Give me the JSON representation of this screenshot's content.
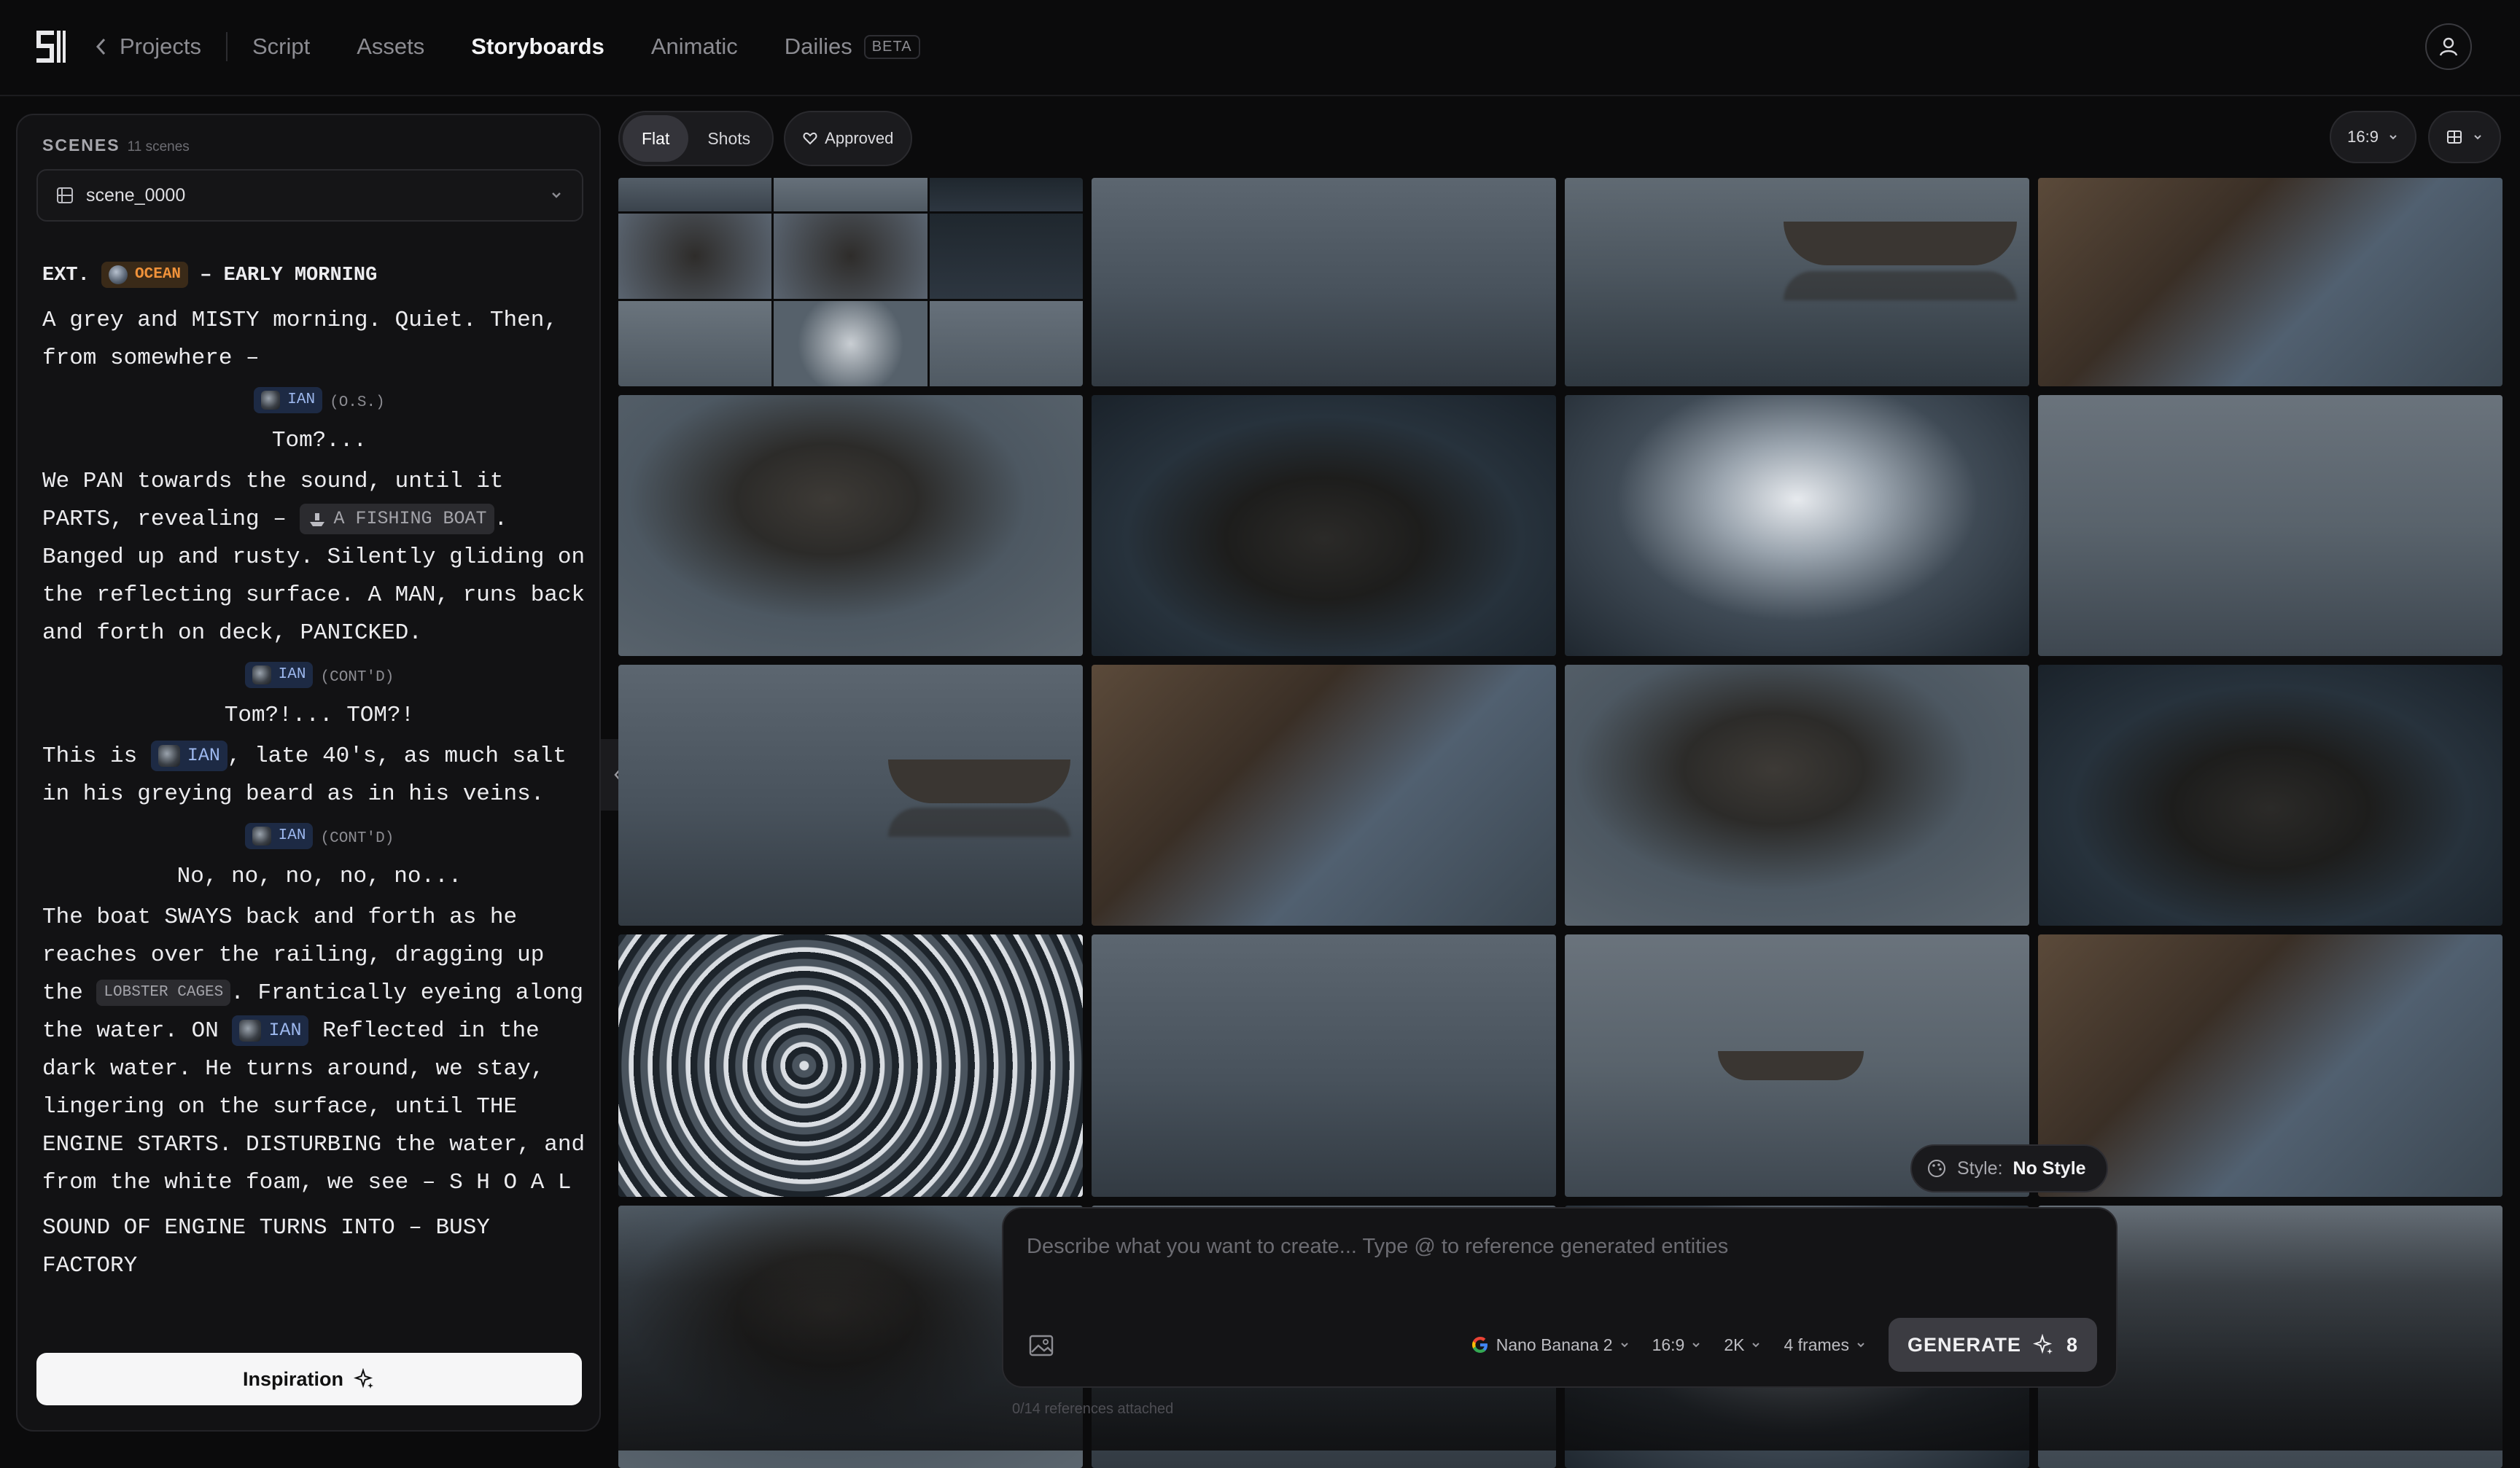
{
  "nav": {
    "back_label": "Projects",
    "tabs": [
      {
        "label": "Script"
      },
      {
        "label": "Assets"
      },
      {
        "label": "Storyboards"
      },
      {
        "label": "Animatic"
      },
      {
        "label": "Dailies"
      }
    ],
    "active_tab": "Storyboards",
    "dailies_badge": "BETA"
  },
  "sidebar": {
    "header": "SCENES",
    "count": "11 scenes",
    "selected_scene": "scene_0000",
    "inspiration_label": "Inspiration"
  },
  "script": {
    "slug_prefix": "EXT.",
    "location_tag": "OCEAN",
    "slug_suffix": "– EARLY MORNING",
    "p1": "A grey and MISTY morning. Quiet. Then, from somewhere –",
    "char_ian": "IAN",
    "os": "(O.S.)",
    "line1": "Tom?...",
    "p2a": "We PAN towards the sound, until it PARTS, revealing –",
    "boat_tag": "A FISHING BOAT",
    "p2b": ". Banged up and rusty. Silently gliding on the reflecting surface. A MAN, runs back and forth on deck, PANICKED.",
    "contd": "(CONT'D)",
    "line2": "Tom?!... TOM?!",
    "p3a": "This is",
    "p3b": ", late 40's, as much salt in his greying beard as in his veins.",
    "line3": "No, no, no, no, no...",
    "p4a": "The boat SWAYS back and forth as he reaches over the railing, dragging up the",
    "cages_tag": "LOBSTER CAGES",
    "p4b": ". Frantically eyeing along the water. ON",
    "p4c": "Reflected in the dark water. He turns around, we stay, lingering on the surface, until THE ENGINE STARTS. DISTURBING the water, and from the white foam, we see – S H O A L",
    "p5": "SOUND OF ENGINE TURNS INTO – BUSY FACTORY"
  },
  "toolbar": {
    "view_options": [
      "Flat",
      "Shots"
    ],
    "active_view": "Flat",
    "approved_label": "Approved",
    "aspect_ratio": "16:9"
  },
  "style_chip": {
    "label": "Style:",
    "value": "No Style"
  },
  "composer": {
    "placeholder": "Describe what you want to create... Type @ to reference generated entities",
    "model": "Nano Banana 2",
    "ratio": "16:9",
    "resolution": "2K",
    "frames": "4 frames",
    "generate_label": "GENERATE",
    "credits": "8",
    "references": "0/14 references attached"
  }
}
